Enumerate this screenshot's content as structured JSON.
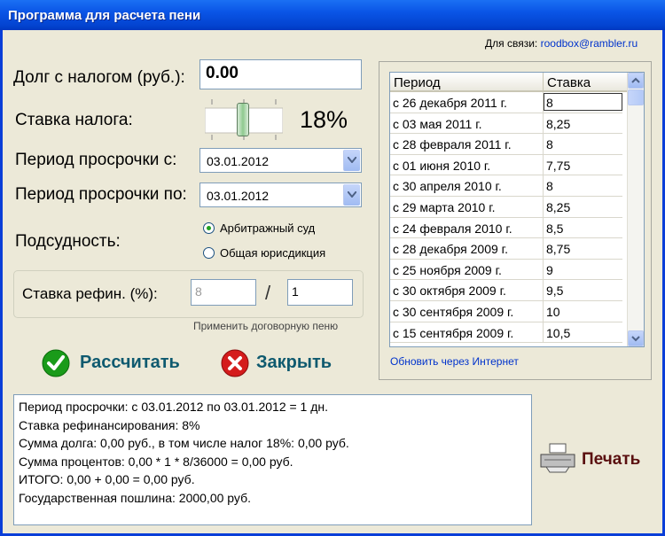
{
  "window": {
    "title": "Программа для расчета пени"
  },
  "contact": {
    "label": "Для связи:",
    "email": "roodbox@rambler.ru"
  },
  "form": {
    "debt_label": "Долг с налогом (руб.):",
    "debt_value": "0.00",
    "tax_label": "Ставка налога:",
    "tax_value": "18%",
    "tax_slider_fraction": 0.5,
    "period_from_label": "Период просрочки с:",
    "period_from_value": "03.01.2012",
    "period_to_label": "Период просрочки по:",
    "period_to_value": "03.01.2012",
    "jurisdiction_label": "Подсудность:",
    "jurisdiction_options": [
      "Арбитражный суд",
      "Общая юрисдикция"
    ],
    "jurisdiction_selected": 0,
    "refin_label": "Ставка рефин. (%):",
    "refin_value": "8",
    "refin_divider": "/",
    "refin_multiplier": "1",
    "apply_contract_label": "Применить договорную пеню"
  },
  "actions": {
    "calculate": "Рассчитать",
    "close": "Закрыть",
    "print": "Печать"
  },
  "rates_table": {
    "headers": [
      "Период",
      "Ставка"
    ],
    "rows": [
      [
        "с 26 декабря 2011 г.",
        "8"
      ],
      [
        "с 03 мая 2011 г.",
        "8,25"
      ],
      [
        "с 28 февраля 2011 г.",
        "8"
      ],
      [
        "с 01 июня 2010 г.",
        "7,75"
      ],
      [
        "с 30 апреля 2010 г.",
        "8"
      ],
      [
        "с 29 марта 2010 г.",
        "8,25"
      ],
      [
        "с 24 февраля 2010 г.",
        "8,5"
      ],
      [
        "с 28 декабря 2009 г.",
        "8,75"
      ],
      [
        "с 25 ноября 2009 г.",
        "9"
      ],
      [
        "с 30 октября 2009 г.",
        "9,5"
      ],
      [
        "с 30 сентября 2009 г.",
        "10"
      ],
      [
        "с 15 сентября 2009 г.",
        "10,5"
      ]
    ],
    "update_link": "Обновить через Интернет"
  },
  "result_lines": [
    "Период просрочки: с 03.01.2012 по 03.01.2012 = 1 дн.",
    "Ставка рефинансирования: 8%",
    "Сумма долга: 0,00 руб., в том числе налог 18%: 0,00 руб.",
    "Сумма процентов: 0,00 * 1 * 8/36000 = 0,00 руб.",
    "ИТОГО: 0,00 + 0,00 = 0,00 руб.",
    "Государственная пошлина: 2000,00 руб."
  ]
}
